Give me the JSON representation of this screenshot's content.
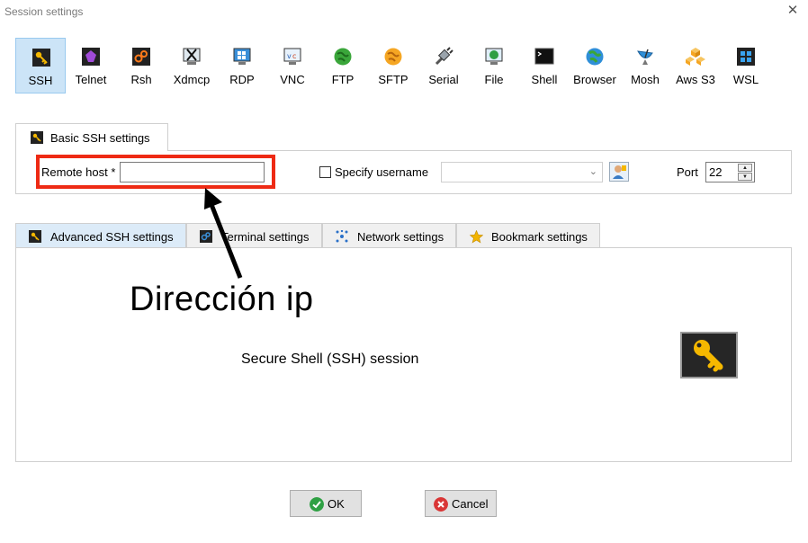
{
  "window": {
    "title": "Session settings",
    "close_glyph": "✕"
  },
  "session_types": [
    {
      "label": "SSH",
      "icon": "ssh-key-icon",
      "selected": true
    },
    {
      "label": "Telnet",
      "icon": "telnet-icon"
    },
    {
      "label": "Rsh",
      "icon": "rsh-icon"
    },
    {
      "label": "Xdmcp",
      "icon": "xdmcp-icon"
    },
    {
      "label": "RDP",
      "icon": "rdp-icon"
    },
    {
      "label": "VNC",
      "icon": "vnc-icon"
    },
    {
      "label": "FTP",
      "icon": "ftp-icon"
    },
    {
      "label": "SFTP",
      "icon": "sftp-icon"
    },
    {
      "label": "Serial",
      "icon": "serial-icon"
    },
    {
      "label": "File",
      "icon": "file-icon"
    },
    {
      "label": "Shell",
      "icon": "shell-icon"
    },
    {
      "label": "Browser",
      "icon": "browser-icon"
    },
    {
      "label": "Mosh",
      "icon": "mosh-icon"
    },
    {
      "label": "Aws S3",
      "icon": "aws-s3-icon"
    },
    {
      "label": "WSL",
      "icon": "wsl-icon"
    }
  ],
  "basic": {
    "tab_label": "Basic SSH settings",
    "remote_host_label": "Remote host *",
    "remote_host_value": "",
    "specify_username_label": "Specify username",
    "specify_username_checked": false,
    "username_value": "",
    "port_label": "Port",
    "port_value": "22"
  },
  "advanced_tabs": [
    {
      "label": "Advanced SSH settings",
      "icon": "ssh-key-icon",
      "active": true
    },
    {
      "label": "Terminal settings",
      "icon": "terminal-icon"
    },
    {
      "label": "Network settings",
      "icon": "network-icon"
    },
    {
      "label": "Bookmark settings",
      "icon": "star-icon"
    }
  ],
  "session_description": "Secure Shell (SSH) session",
  "annotation": {
    "text": "Dirección ip"
  },
  "buttons": {
    "ok": "OK",
    "cancel": "Cancel"
  },
  "colors": {
    "selected_bg": "#cce4f7",
    "highlight_red": "#ee2a14",
    "ok_green": "#2ea043",
    "cancel_red": "#d93636",
    "key_gold": "#f5b800"
  }
}
